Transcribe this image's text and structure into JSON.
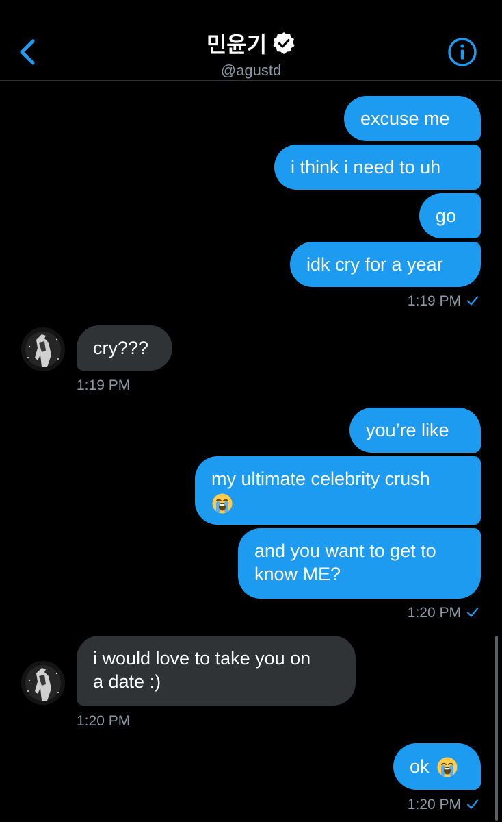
{
  "header": {
    "title": "민윤기",
    "handle": "@agustd"
  },
  "messages": {
    "m1": "excuse me",
    "m2": "i think i need to uh",
    "m3": "go",
    "m4": "idk cry for a year",
    "ts1": "1:19 PM",
    "r1": "cry???",
    "ts2": "1:19 PM",
    "m5": "you’re like",
    "m6_line1": "my ultimate celebrity crush",
    "m7_line1": "and you want to get to",
    "m7_line2": "know ME?",
    "ts3": "1:20 PM",
    "r2_line1": "i would love to take you on",
    "r2_line2": "a date :)",
    "ts4": "1:20 PM",
    "m8": "ok",
    "ts5": "1:20 PM"
  },
  "icons": {
    "back": "chevron-left-icon",
    "verified": "verified-badge-icon",
    "info": "info-circle-icon",
    "read": "checkmark-icon",
    "emoji": "loudly-crying-face-emoji"
  },
  "colors": {
    "accent": "#1d9bf0",
    "received_bubble": "#2f3336",
    "background": "#000000",
    "muted_text": "#8b98a5"
  }
}
